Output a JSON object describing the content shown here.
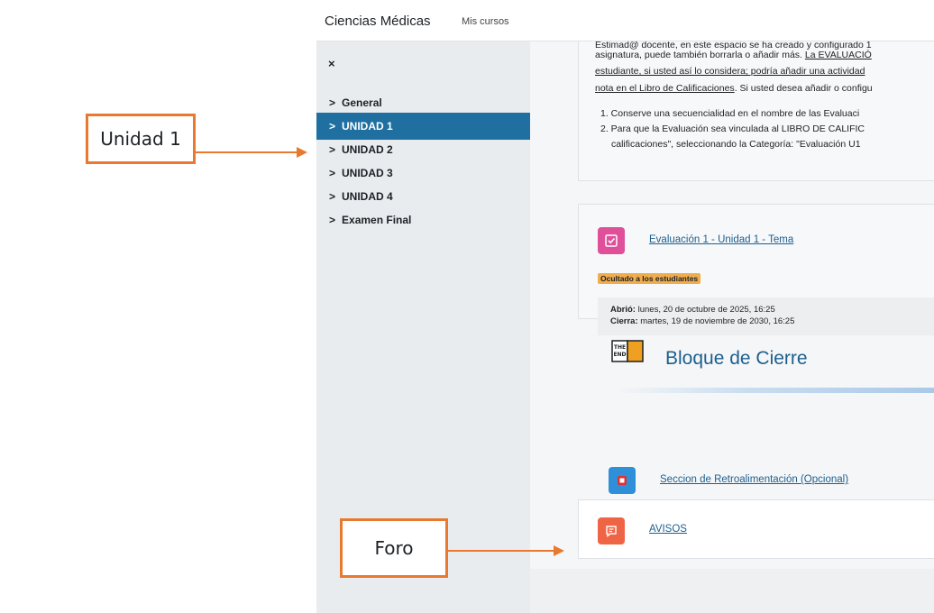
{
  "navbar": {
    "site_name": "Ciencias Médicas",
    "my_courses": "Mis cursos"
  },
  "drawer": {
    "close_glyph": "×",
    "items": [
      {
        "label": "General",
        "active": false
      },
      {
        "label": "UNIDAD 1",
        "active": true
      },
      {
        "label": "UNIDAD 2",
        "active": false
      },
      {
        "label": "UNIDAD 3",
        "active": false
      },
      {
        "label": "UNIDAD 4",
        "active": false
      },
      {
        "label": "Examen Final",
        "active": false
      }
    ]
  },
  "intro": {
    "line0": "Estimad@ docente, en este espacio se ha creado y configurado 1",
    "line1_a": "asignatura, puede también borrarla o añadir más. ",
    "line1_b": "La EVALUACIÓ",
    "line2_a": "estudiante, si usted así lo considera; podría añadir una actividad",
    "line3_a": "nota en el Libro de Calificaciones",
    "line3_b": ". Si usted desea añadir o configu",
    "item1": "1. Conserve una secuencialidad en el nombre de las Evaluaci",
    "item2": "2. Para que la Evaluación sea vinculada al LIBRO DE CALIFIC",
    "item2_cont": "calificaciones\", seleccionando la Categoría: \"Evaluación U1"
  },
  "activity": {
    "link": "Evaluación 1 - Unidad 1 - Tema",
    "badge": "Ocultado a los estudiantes",
    "opened_label": "Abrió:",
    "opened_value": " lunes, 20 de octubre de 2025, 16:25",
    "closes_label": "Cierra:",
    "closes_value": " martes, 19 de noviembre de 2030, 16:25"
  },
  "closing_block": {
    "title": "Bloque de Cierre",
    "icon_text_top": "THE",
    "icon_text_bottom": "END"
  },
  "feedback": {
    "link": "Seccion de Retroalimentación (Opcional)"
  },
  "forum": {
    "link": "AVISOS"
  },
  "annotations": {
    "unit_callout": "Unidad 1",
    "forum_callout": "Foro"
  },
  "colors": {
    "accent": "#1f6fa0",
    "link": "#1d5f8f",
    "callout": "#e8792e",
    "quiz_icon": "#e0509a",
    "forum_icon": "#f06446",
    "feedback_icon": "#2f8fd8",
    "badge": "#f0ad4e"
  }
}
